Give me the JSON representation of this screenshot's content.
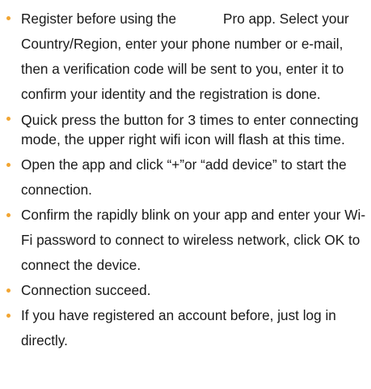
{
  "instructions": [
    {
      "text_before": "Register before using the",
      "text_after": "Pro app. Select your Country/Region, enter your phone number or e-mail, then a verification code will be sent to you, enter it to confirm your identity and the registration is done."
    },
    {
      "text": "Quick press the button for 3 times to enter connecting mode, the upper right wifi icon will flash at this time."
    },
    {
      "text": "Open the app and click “+”or “add device” to start the connection."
    },
    {
      "text": "Confirm the rapidly blink on your app and enter your Wi-Fi password to connect to wireless network, click OK to connect the device."
    },
    {
      "text": "Connection succeed."
    },
    {
      "text": "If you have registered an account before, just log in directly."
    }
  ],
  "colors": {
    "bullet": "#f2a531",
    "text": "#1a1a1a",
    "background": "#ffffff"
  },
  "icons": {
    "bullet": "orange-dot-bullet"
  }
}
